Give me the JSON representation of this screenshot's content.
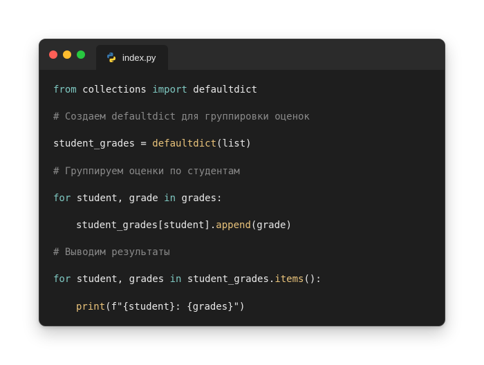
{
  "window": {
    "tab": {
      "filename": "index.py",
      "icon": "python-icon"
    }
  },
  "code": {
    "line1": {
      "kw1": "from",
      "mod": " collections ",
      "kw2": "import",
      "name": " defaultdict"
    },
    "line2": {
      "comment": "# Создаем defaultdict для группировки оценок"
    },
    "line3": {
      "var": "student_grades = ",
      "fn": "defaultdict",
      "args": "(list)"
    },
    "line4": {
      "comment": "# Группируем оценки по студентам"
    },
    "line5": {
      "kw1": "for",
      "vars": " student, grade ",
      "kw2": "in",
      "iter": " grades:"
    },
    "line6": {
      "obj": "student_grades[student].",
      "fn": "append",
      "args": "(grade)"
    },
    "line7": {
      "comment": "# Выводим результаты"
    },
    "line8": {
      "kw1": "for",
      "vars": " student, grades ",
      "kw2": "in",
      "obj": " student_grades.",
      "fn": "items",
      "args": "():"
    },
    "line9": {
      "fn": "print",
      "args": "(f\"{student}: {grades}\")"
    }
  },
  "colors": {
    "keyword": "#7ec7c0",
    "function": "#e8c27a",
    "comment": "#8a8a8a",
    "text": "#e8e8e8",
    "background": "#1e1e1e",
    "titlebar": "#2b2b2b"
  }
}
